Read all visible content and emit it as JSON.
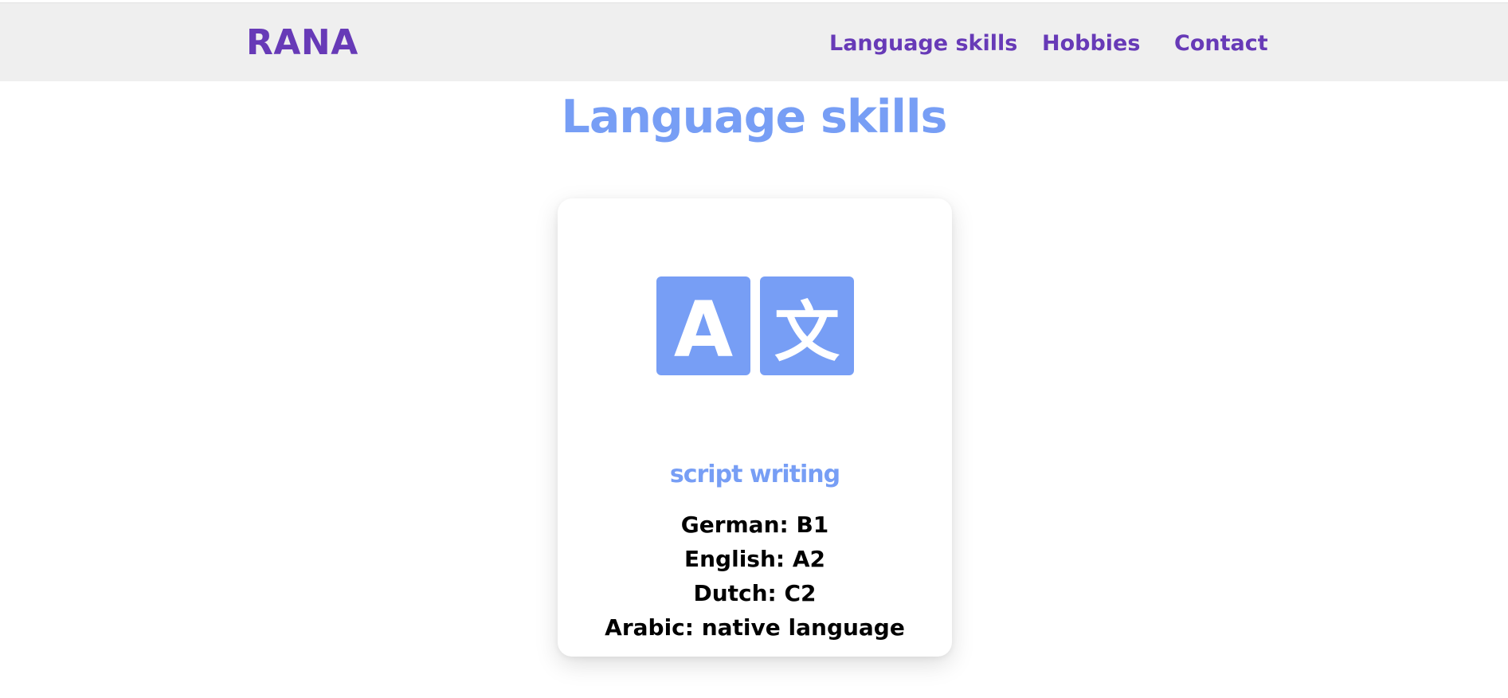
{
  "header": {
    "logo": "RANA",
    "nav": [
      {
        "label": "Language skills"
      },
      {
        "label": "Hobbies"
      },
      {
        "label": "Contact"
      }
    ]
  },
  "section": {
    "title": "Language skills"
  },
  "card": {
    "icon": "translate-icon",
    "icon_letters": [
      "A",
      "文"
    ],
    "subtitle": "script writing",
    "languages": [
      "German: B1",
      "English: A2",
      "Dutch: C2",
      "Arabic: native language"
    ]
  },
  "colors": {
    "brand_purple": "#673ab7",
    "accent_blue": "#779ef5",
    "header_bg": "#efefef"
  }
}
